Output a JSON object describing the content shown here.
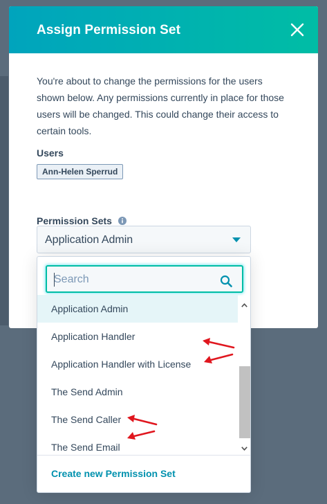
{
  "modal": {
    "title": "Assign Permission Set",
    "intro": "You're about to change the permissions for the users shown below. Any permissions currently in place for those users will be changed. This could change their access to certain tools.",
    "users_label": "Users",
    "user_tag": "Ann-Helen Sperrud",
    "permission_sets_label": "Permission Sets"
  },
  "select": {
    "value": "Application Admin"
  },
  "dropdown": {
    "search_placeholder": "Search",
    "options": [
      "Application Admin",
      "Application Handler",
      "Application Handler with License",
      "The Send Admin",
      "The Send Caller",
      "The Send Email"
    ],
    "selected_index": 0,
    "create_link": "Create new Permission Set"
  },
  "colors": {
    "header_start": "#00a4bd",
    "header_end": "#00bda5",
    "text": "#33475b",
    "link": "#0091ae",
    "annotation_arrow": "#e0161e"
  },
  "icons": [
    "close-icon",
    "info-icon",
    "caret-down-icon",
    "search-icon",
    "scroll-up-icon",
    "scroll-down-icon"
  ]
}
